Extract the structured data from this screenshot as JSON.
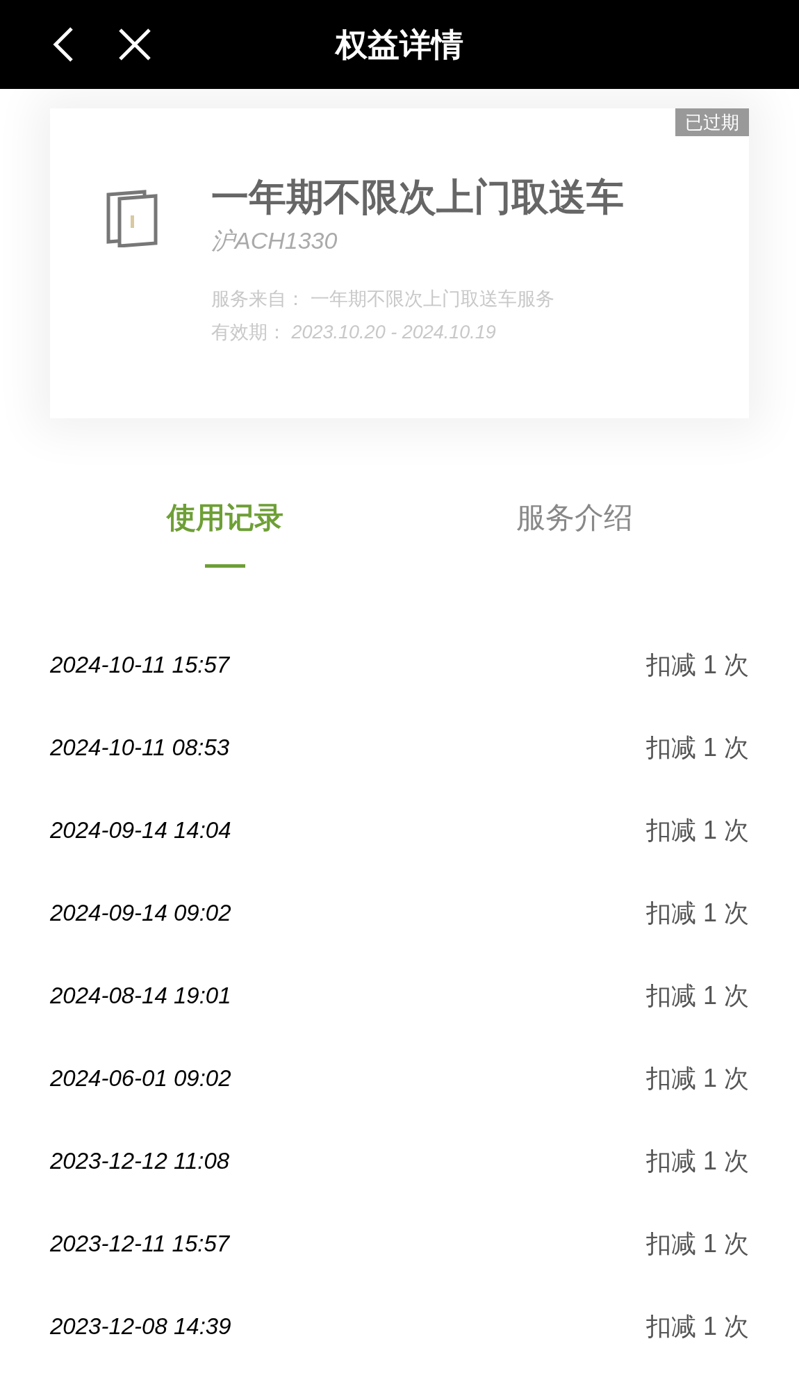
{
  "header": {
    "title": "权益详情"
  },
  "card": {
    "badge": "已过期",
    "title": "一年期不限次上门取送车",
    "plate": "沪ACH1330",
    "source_label": "服务来自：",
    "source": "一年期不限次上门取送车服务",
    "validity_label": "有效期：",
    "validity": "2023.10.20 - 2024.10.19"
  },
  "tabs": [
    {
      "label": "使用记录",
      "selected": true
    },
    {
      "label": "服务介绍",
      "selected": false
    }
  ],
  "records": [
    {
      "time": "2024-10-11 15:57",
      "amount": "扣减 1 次"
    },
    {
      "time": "2024-10-11 08:53",
      "amount": "扣减 1 次"
    },
    {
      "time": "2024-09-14 14:04",
      "amount": "扣减 1 次"
    },
    {
      "time": "2024-09-14 09:02",
      "amount": "扣减 1 次"
    },
    {
      "time": "2024-08-14 19:01",
      "amount": "扣减 1 次"
    },
    {
      "time": "2024-06-01 09:02",
      "amount": "扣减 1 次"
    },
    {
      "time": "2023-12-12 11:08",
      "amount": "扣减 1 次"
    },
    {
      "time": "2023-12-11 15:57",
      "amount": "扣减 1 次"
    },
    {
      "time": "2023-12-08 14:39",
      "amount": "扣减 1 次"
    }
  ]
}
